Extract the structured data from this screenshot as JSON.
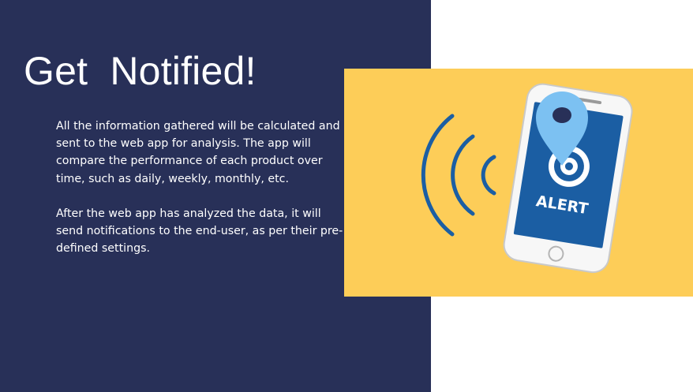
{
  "slide": {
    "title": "Get  Notified!",
    "paragraphs": [
      "All the information gathered will be calculated and sent to the web app for analysis. The app will compare the performance of each product over time, such as daily, weekly, monthly, etc.",
      "After the web app has analyzed the data, it will send notifications to the end-user, as per their pre-defined settings."
    ]
  },
  "illustration": {
    "alert_label": "ALERT",
    "icons": [
      "phone-icon",
      "location-pin-icon",
      "signal-waves-icon"
    ],
    "colors": {
      "left_panel": "#283058",
      "illustration_bg": "#fdcd58",
      "phone_screen": "#1b5ea3",
      "pin": "#7cc1f2",
      "waves": "#1b5ea3"
    }
  }
}
